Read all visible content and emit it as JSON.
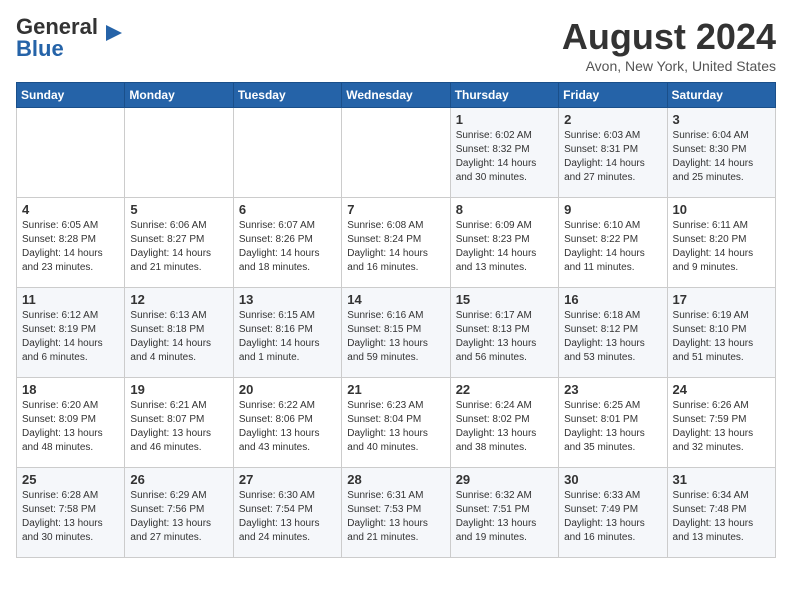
{
  "header": {
    "logo_general": "General",
    "logo_blue": "Blue",
    "month": "August 2024",
    "location": "Avon, New York, United States"
  },
  "days_of_week": [
    "Sunday",
    "Monday",
    "Tuesday",
    "Wednesday",
    "Thursday",
    "Friday",
    "Saturday"
  ],
  "weeks": [
    [
      {
        "day": "",
        "info": ""
      },
      {
        "day": "",
        "info": ""
      },
      {
        "day": "",
        "info": ""
      },
      {
        "day": "",
        "info": ""
      },
      {
        "day": "1",
        "info": "Sunrise: 6:02 AM\nSunset: 8:32 PM\nDaylight: 14 hours\nand 30 minutes."
      },
      {
        "day": "2",
        "info": "Sunrise: 6:03 AM\nSunset: 8:31 PM\nDaylight: 14 hours\nand 27 minutes."
      },
      {
        "day": "3",
        "info": "Sunrise: 6:04 AM\nSunset: 8:30 PM\nDaylight: 14 hours\nand 25 minutes."
      }
    ],
    [
      {
        "day": "4",
        "info": "Sunrise: 6:05 AM\nSunset: 8:28 PM\nDaylight: 14 hours\nand 23 minutes."
      },
      {
        "day": "5",
        "info": "Sunrise: 6:06 AM\nSunset: 8:27 PM\nDaylight: 14 hours\nand 21 minutes."
      },
      {
        "day": "6",
        "info": "Sunrise: 6:07 AM\nSunset: 8:26 PM\nDaylight: 14 hours\nand 18 minutes."
      },
      {
        "day": "7",
        "info": "Sunrise: 6:08 AM\nSunset: 8:24 PM\nDaylight: 14 hours\nand 16 minutes."
      },
      {
        "day": "8",
        "info": "Sunrise: 6:09 AM\nSunset: 8:23 PM\nDaylight: 14 hours\nand 13 minutes."
      },
      {
        "day": "9",
        "info": "Sunrise: 6:10 AM\nSunset: 8:22 PM\nDaylight: 14 hours\nand 11 minutes."
      },
      {
        "day": "10",
        "info": "Sunrise: 6:11 AM\nSunset: 8:20 PM\nDaylight: 14 hours\nand 9 minutes."
      }
    ],
    [
      {
        "day": "11",
        "info": "Sunrise: 6:12 AM\nSunset: 8:19 PM\nDaylight: 14 hours\nand 6 minutes."
      },
      {
        "day": "12",
        "info": "Sunrise: 6:13 AM\nSunset: 8:18 PM\nDaylight: 14 hours\nand 4 minutes."
      },
      {
        "day": "13",
        "info": "Sunrise: 6:15 AM\nSunset: 8:16 PM\nDaylight: 14 hours\nand 1 minute."
      },
      {
        "day": "14",
        "info": "Sunrise: 6:16 AM\nSunset: 8:15 PM\nDaylight: 13 hours\nand 59 minutes."
      },
      {
        "day": "15",
        "info": "Sunrise: 6:17 AM\nSunset: 8:13 PM\nDaylight: 13 hours\nand 56 minutes."
      },
      {
        "day": "16",
        "info": "Sunrise: 6:18 AM\nSunset: 8:12 PM\nDaylight: 13 hours\nand 53 minutes."
      },
      {
        "day": "17",
        "info": "Sunrise: 6:19 AM\nSunset: 8:10 PM\nDaylight: 13 hours\nand 51 minutes."
      }
    ],
    [
      {
        "day": "18",
        "info": "Sunrise: 6:20 AM\nSunset: 8:09 PM\nDaylight: 13 hours\nand 48 minutes."
      },
      {
        "day": "19",
        "info": "Sunrise: 6:21 AM\nSunset: 8:07 PM\nDaylight: 13 hours\nand 46 minutes."
      },
      {
        "day": "20",
        "info": "Sunrise: 6:22 AM\nSunset: 8:06 PM\nDaylight: 13 hours\nand 43 minutes."
      },
      {
        "day": "21",
        "info": "Sunrise: 6:23 AM\nSunset: 8:04 PM\nDaylight: 13 hours\nand 40 minutes."
      },
      {
        "day": "22",
        "info": "Sunrise: 6:24 AM\nSunset: 8:02 PM\nDaylight: 13 hours\nand 38 minutes."
      },
      {
        "day": "23",
        "info": "Sunrise: 6:25 AM\nSunset: 8:01 PM\nDaylight: 13 hours\nand 35 minutes."
      },
      {
        "day": "24",
        "info": "Sunrise: 6:26 AM\nSunset: 7:59 PM\nDaylight: 13 hours\nand 32 minutes."
      }
    ],
    [
      {
        "day": "25",
        "info": "Sunrise: 6:28 AM\nSunset: 7:58 PM\nDaylight: 13 hours\nand 30 minutes."
      },
      {
        "day": "26",
        "info": "Sunrise: 6:29 AM\nSunset: 7:56 PM\nDaylight: 13 hours\nand 27 minutes."
      },
      {
        "day": "27",
        "info": "Sunrise: 6:30 AM\nSunset: 7:54 PM\nDaylight: 13 hours\nand 24 minutes."
      },
      {
        "day": "28",
        "info": "Sunrise: 6:31 AM\nSunset: 7:53 PM\nDaylight: 13 hours\nand 21 minutes."
      },
      {
        "day": "29",
        "info": "Sunrise: 6:32 AM\nSunset: 7:51 PM\nDaylight: 13 hours\nand 19 minutes."
      },
      {
        "day": "30",
        "info": "Sunrise: 6:33 AM\nSunset: 7:49 PM\nDaylight: 13 hours\nand 16 minutes."
      },
      {
        "day": "31",
        "info": "Sunrise: 6:34 AM\nSunset: 7:48 PM\nDaylight: 13 hours\nand 13 minutes."
      }
    ]
  ]
}
